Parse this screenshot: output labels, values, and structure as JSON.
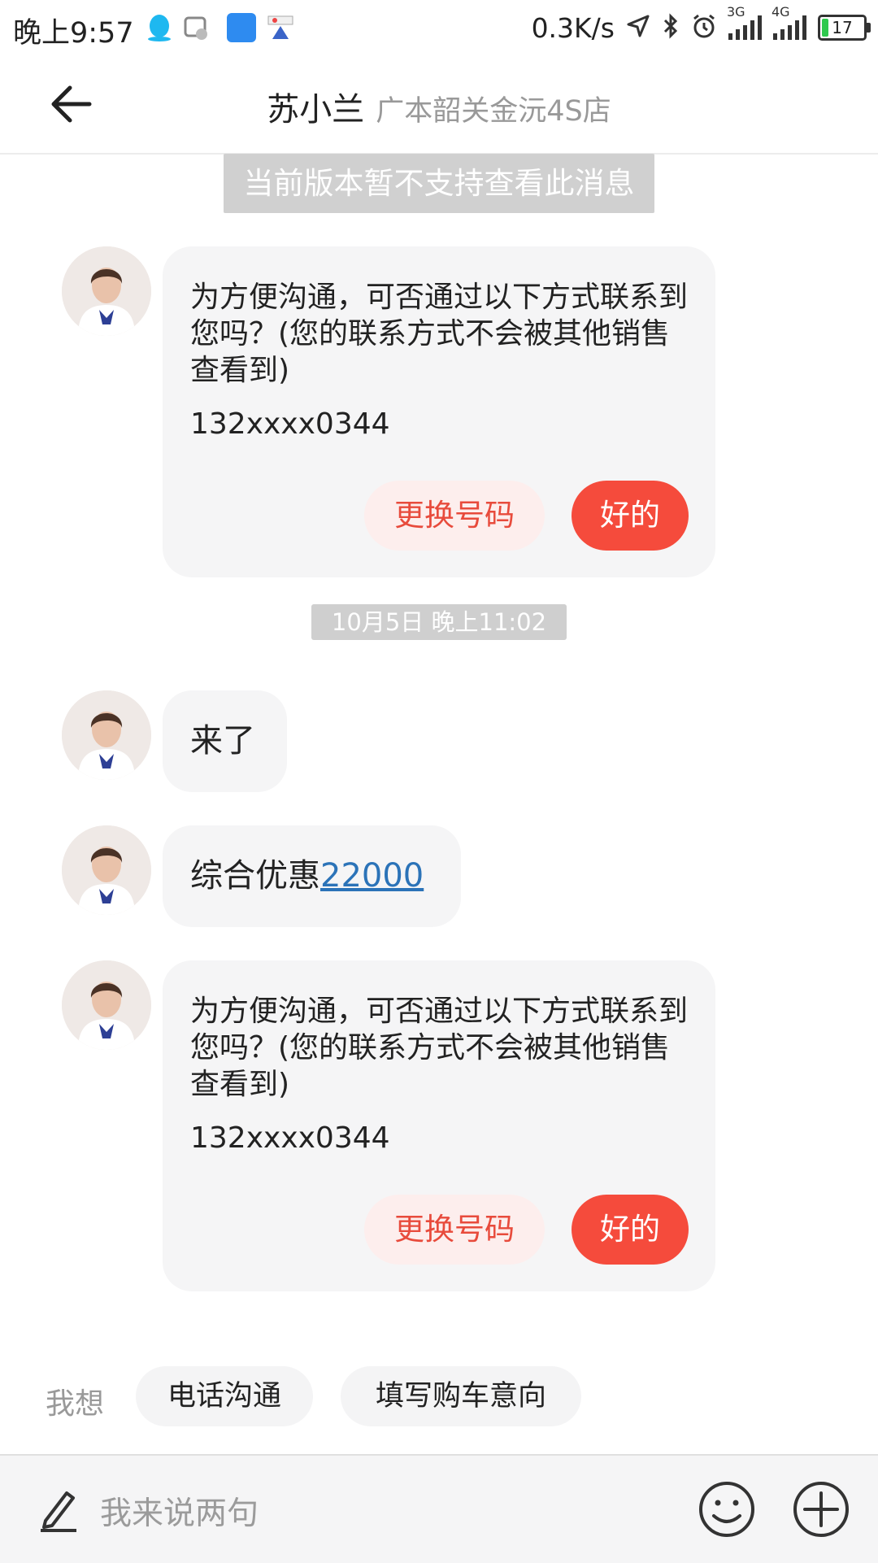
{
  "status_bar": {
    "time": "晚上9:57",
    "net_speed": "0.3K/s",
    "signal1_label": "3G",
    "signal2_label": "4G",
    "battery": "17"
  },
  "header": {
    "name": "苏小兰",
    "store": "广本韶关金沅4S店"
  },
  "system_notice": "当前版本暂不支持查看此消息",
  "messages": [
    {
      "text": "为方便沟通，可否通过以下方式联系到您吗？(您的联系方式不会被其他销售查看到)",
      "phone": "132xxxx0344",
      "change_label": "更换号码",
      "ok_label": "好的"
    },
    {
      "text": "来了"
    },
    {
      "text": "综合优惠",
      "link": "22000"
    },
    {
      "text": "为方便沟通，可否通过以下方式联系到您吗？(您的联系方式不会被其他销售查看到)",
      "phone": "132xxxx0344",
      "change_label": "更换号码",
      "ok_label": "好的"
    }
  ],
  "timestamp": "10月5日 晚上11:02",
  "quick_actions": {
    "label": "我想",
    "items": [
      "电话沟通",
      "填写购车意向"
    ]
  },
  "input": {
    "placeholder": "我来说两句"
  },
  "colors": {
    "accent": "#f54b3c",
    "accent_light": "#fdeeed",
    "bubble_bg": "#f5f5f6",
    "link": "#2b73b8"
  }
}
